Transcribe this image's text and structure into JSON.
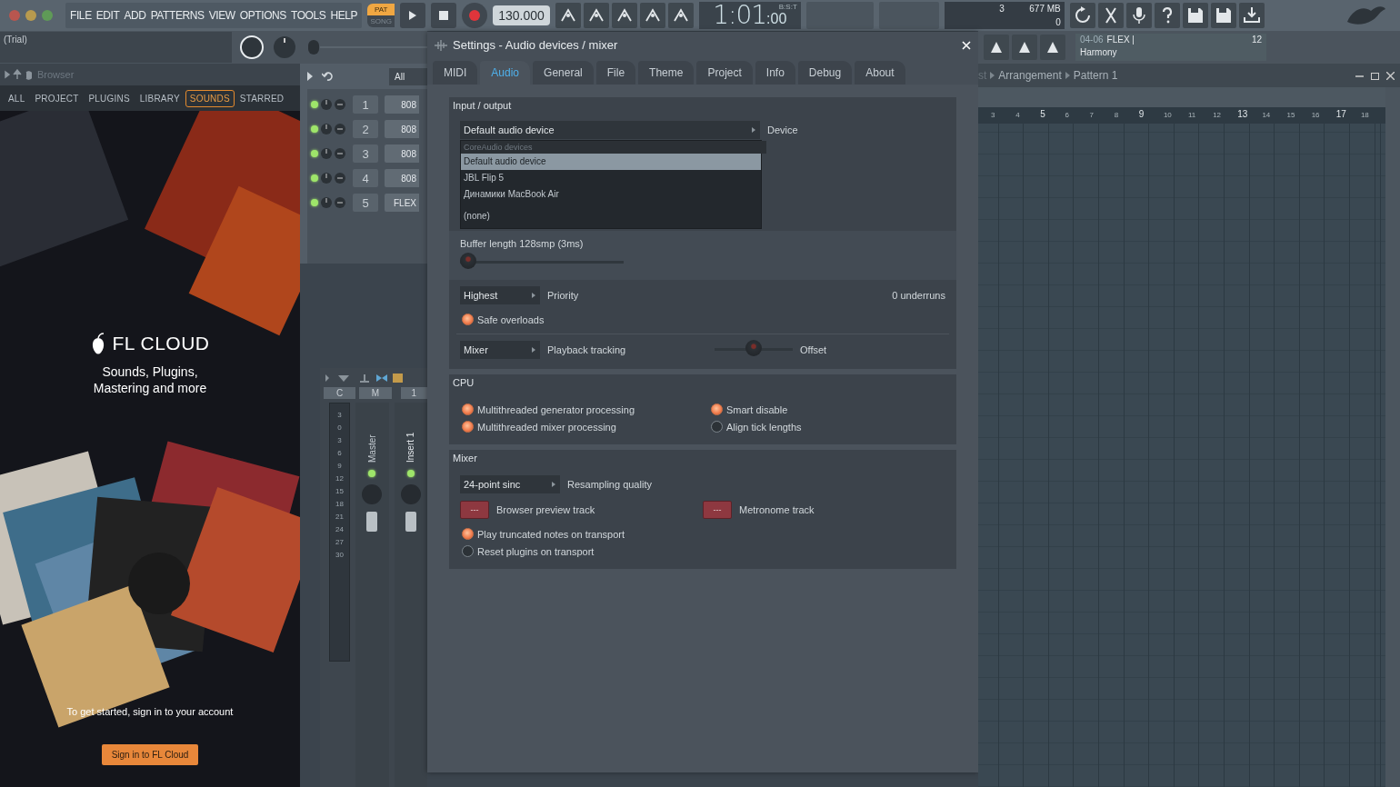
{
  "window_buttons": [
    {
      "color": "#b9564f"
    },
    {
      "color": "#b89a4e"
    },
    {
      "color": "#5f9a57"
    }
  ],
  "menu": [
    "FILE",
    "EDIT",
    "ADD",
    "PATTERNS",
    "VIEW",
    "OPTIONS",
    "TOOLS",
    "HELP"
  ],
  "transport": {
    "modes": [
      {
        "label": "PAT",
        "selected": true
      },
      {
        "label": "SONG",
        "selected": false
      }
    ],
    "tempo": "130.000",
    "time_main": "1:01",
    "time_sub": ":00",
    "time_label": "B:S:T"
  },
  "monitor": {
    "cpu": "3",
    "memory": "677 MB",
    "polyphony": "0"
  },
  "hint": {
    "position": "04-06",
    "title": "FLEX |",
    "subtitle": "Harmony",
    "count": "12"
  },
  "browser": {
    "preset": "(Trial)",
    "title": "Browser",
    "tabs": [
      {
        "label": "ALL",
        "selected": false
      },
      {
        "label": "PROJECT",
        "selected": false
      },
      {
        "label": "PLUGINS",
        "selected": false
      },
      {
        "label": "LIBRARY",
        "selected": false
      },
      {
        "label": "SOUNDS",
        "selected": true
      },
      {
        "label": "STARRED",
        "selected": false
      }
    ],
    "promo": {
      "brand": "FL CLOUD",
      "tagline": [
        "Sounds, Plugins,",
        "Mastering and more"
      ],
      "prompt": "To get started, sign in to your account",
      "button": "Sign in to FL Cloud"
    }
  },
  "channel_rack": {
    "filter": "All",
    "channels": [
      {
        "number": "1",
        "name": "808"
      },
      {
        "number": "2",
        "name": "808"
      },
      {
        "number": "3",
        "name": "808"
      },
      {
        "number": "4",
        "name": "808"
      },
      {
        "number": "5",
        "name": "FLEX"
      }
    ]
  },
  "mixer": {
    "header": [
      "C",
      "M",
      "1"
    ],
    "scale": [
      "3",
      "0",
      "3",
      "6",
      "9",
      "12",
      "15",
      "18",
      "21",
      "24",
      "27",
      "30"
    ],
    "tracks": [
      {
        "name": "Master"
      },
      {
        "name": "Insert 1"
      }
    ]
  },
  "settings": {
    "title": "Settings - Audio devices / mixer",
    "tabs": [
      {
        "label": "MIDI",
        "selected": false
      },
      {
        "label": "Audio",
        "selected": true
      },
      {
        "label": "General",
        "selected": false
      },
      {
        "label": "File",
        "selected": false
      },
      {
        "label": "Theme",
        "selected": false
      },
      {
        "label": "Project",
        "selected": false
      },
      {
        "label": "Info",
        "selected": false
      },
      {
        "label": "Debug",
        "selected": false
      },
      {
        "label": "About",
        "selected": false
      }
    ],
    "input_output": {
      "title": "Input / output",
      "device": {
        "value": "Default audio device",
        "label": "Device",
        "expanded": true,
        "options": [
          {
            "kind": "header",
            "label": "CoreAudio devices",
            "selected": false
          },
          {
            "kind": "option",
            "label": "Default audio device",
            "selected": true
          },
          {
            "kind": "option",
            "label": "JBL Flip 5",
            "selected": false
          },
          {
            "kind": "option",
            "label": "Динамики MacBook Air",
            "selected": false
          },
          {
            "kind": "option",
            "label": "(none)",
            "selected": false
          }
        ]
      },
      "buffer": {
        "label": "Buffer length 128smp (3ms)",
        "level": 0
      },
      "priority": {
        "value": "Highest",
        "label": "Priority"
      },
      "underruns": "0 underruns",
      "safe_overloads": {
        "label": "Safe overloads",
        "checked": true
      },
      "playback_tracking": {
        "value": "Mixer",
        "label": "Playback tracking"
      },
      "offset": {
        "label": "Offset",
        "level": 0.5
      }
    },
    "cpu": {
      "title": "CPU",
      "options": [
        {
          "label": "Multithreaded generator processing",
          "checked": true
        },
        {
          "label": "Smart disable",
          "checked": true
        },
        {
          "label": "Multithreaded mixer processing",
          "checked": true
        },
        {
          "label": "Align tick lengths",
          "checked": false
        }
      ]
    },
    "mixer": {
      "title": "Mixer",
      "resampling": {
        "value": "24-point sinc",
        "label": "Resampling quality"
      },
      "tracks": [
        {
          "value": "---",
          "label": "Browser preview track"
        },
        {
          "value": "---",
          "label": "Metronome track"
        }
      ],
      "options": [
        {
          "label": "Play truncated notes on transport",
          "checked": true
        },
        {
          "label": "Reset plugins on transport",
          "checked": false
        }
      ]
    }
  },
  "playlist": {
    "breadcrumb": [
      "st",
      "Arrangement",
      "Pattern 1"
    ],
    "ruler": [
      {
        "label": "3",
        "major": false
      },
      {
        "label": "4",
        "major": false
      },
      {
        "label": "5",
        "major": true
      },
      {
        "label": "6",
        "major": false
      },
      {
        "label": "7",
        "major": false
      },
      {
        "label": "8",
        "major": false
      },
      {
        "label": "9",
        "major": true
      },
      {
        "label": "10",
        "major": false
      },
      {
        "label": "11",
        "major": false
      },
      {
        "label": "12",
        "major": false
      },
      {
        "label": "13",
        "major": true
      },
      {
        "label": "14",
        "major": false
      },
      {
        "label": "15",
        "major": false
      },
      {
        "label": "16",
        "major": false
      },
      {
        "label": "17",
        "major": true
      },
      {
        "label": "18",
        "major": false
      }
    ]
  }
}
